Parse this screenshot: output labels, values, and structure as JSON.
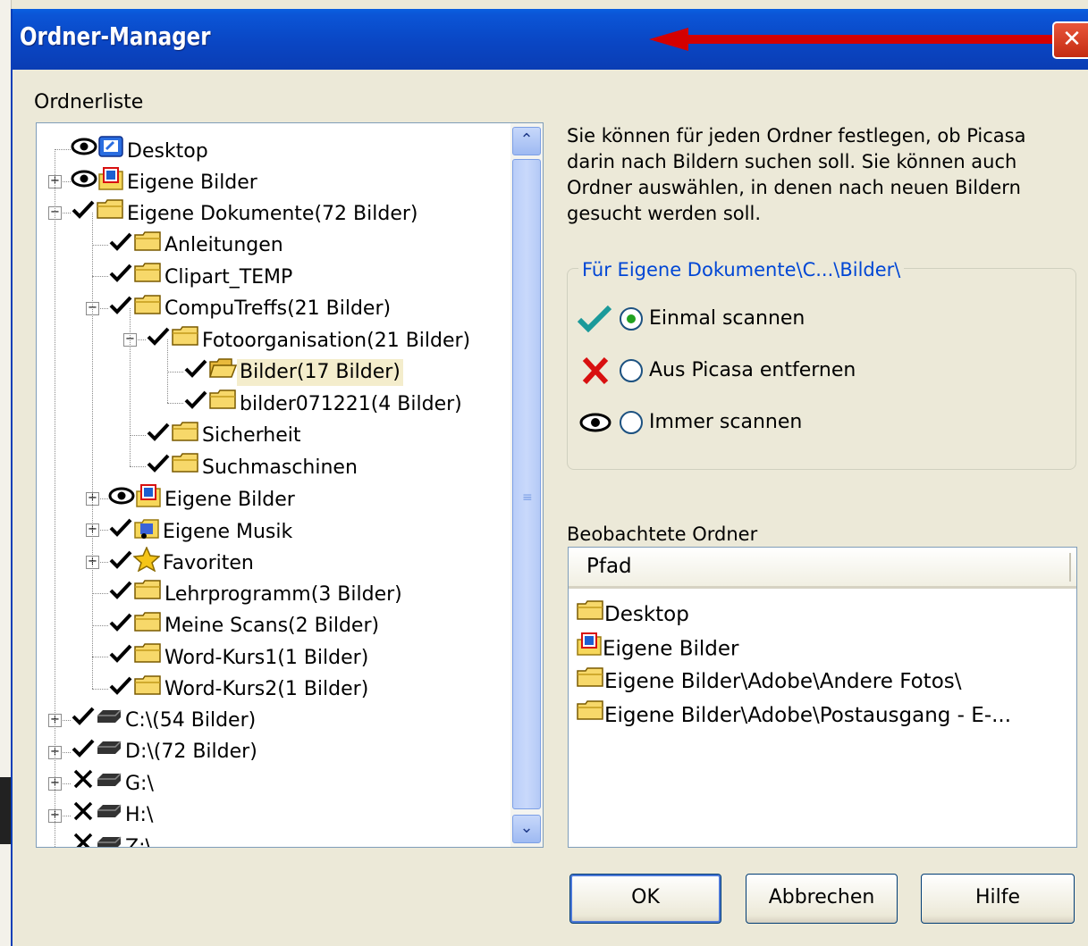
{
  "window": {
    "title": "Ordner-Manager"
  },
  "tree": {
    "label": "Ordnerliste",
    "nodes": [
      {
        "text": "Desktop",
        "state": "eye",
        "icon": "desktop-icon"
      },
      {
        "text": "Eigene Bilder",
        "state": "eye",
        "icon": "pictures-folder-icon"
      },
      {
        "text": "Eigene Dokumente(72 Bilder)",
        "state": "check",
        "icon": "folder-icon"
      },
      {
        "text": "Anleitungen",
        "state": "check",
        "icon": "folder-icon"
      },
      {
        "text": "Clipart_TEMP",
        "state": "check",
        "icon": "folder-icon"
      },
      {
        "text": "CompuTreffs(21 Bilder)",
        "state": "check",
        "icon": "folder-icon"
      },
      {
        "text": "Fotoorganisation(21 Bilder)",
        "state": "check",
        "icon": "folder-icon"
      },
      {
        "text": "Bilder(17 Bilder)",
        "state": "check",
        "icon": "folder-open-icon"
      },
      {
        "text": "bilder071221(4 Bilder)",
        "state": "check",
        "icon": "folder-icon"
      },
      {
        "text": "Sicherheit",
        "state": "check",
        "icon": "folder-icon"
      },
      {
        "text": "Suchmaschinen",
        "state": "check",
        "icon": "folder-icon"
      },
      {
        "text": "Eigene Bilder",
        "state": "eye",
        "icon": "pictures-folder-icon"
      },
      {
        "text": "Eigene Musik",
        "state": "check",
        "icon": "music-folder-icon"
      },
      {
        "text": "Favoriten",
        "state": "check",
        "icon": "star-icon"
      },
      {
        "text": "Lehrprogramm(3 Bilder)",
        "state": "check",
        "icon": "folder-icon"
      },
      {
        "text": "Meine Scans(2 Bilder)",
        "state": "check",
        "icon": "folder-icon"
      },
      {
        "text": "Word-Kurs1(1 Bilder)",
        "state": "check",
        "icon": "folder-icon"
      },
      {
        "text": "Word-Kurs2(1 Bilder)",
        "state": "check",
        "icon": "folder-icon"
      },
      {
        "text": "C:\\(54 Bilder)",
        "state": "check",
        "icon": "drive-icon"
      },
      {
        "text": "D:\\(72 Bilder)",
        "state": "check",
        "icon": "drive-icon"
      },
      {
        "text": "G:\\",
        "state": "cross",
        "icon": "drive-icon"
      },
      {
        "text": "H:\\",
        "state": "cross",
        "icon": "drive-icon"
      },
      {
        "text": "Z:\\",
        "state": "cross",
        "icon": "network-drive-icon"
      }
    ]
  },
  "description": "Sie können für jeden Ordner festlegen, ob Picasa darin nach Bildern suchen soll.  Sie können auch Ordner auswählen, in denen nach neuen Bildern gesucht werden soll.",
  "options": {
    "legend": "Für Eigene Dokumente\\C...\\Bilder\\",
    "once": "Einmal scannen",
    "remove": "Aus Picasa entfernen",
    "always": "Immer scannen",
    "selected": "Einmal scannen"
  },
  "watched": {
    "label": "Beobachtete Ordner",
    "column": "Pfad",
    "rows": [
      "Desktop",
      "Eigene Bilder",
      "Eigene Bilder\\Adobe\\Andere Fotos\\",
      "Eigene Bilder\\Adobe\\Postausgang - E-..."
    ]
  },
  "buttons": {
    "ok": "OK",
    "cancel": "Abbrechen",
    "help": "Hilfe"
  },
  "colors": {
    "titlebar": "#0a46c4",
    "arrow": "#d40000",
    "legend": "#0046d5",
    "check_teal": "#1b9a9a",
    "cross_red": "#d81010"
  }
}
